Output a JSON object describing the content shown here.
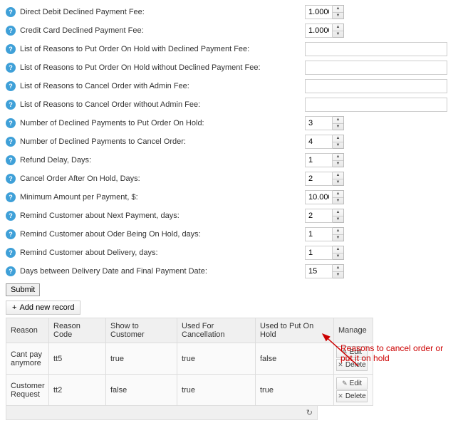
{
  "fields": {
    "direct_debit_fee": {
      "label": "Direct Debit Declined Payment Fee:",
      "value": "1.0000",
      "type": "number"
    },
    "credit_card_fee": {
      "label": "Credit Card Declined Payment Fee:",
      "value": "1.0000",
      "type": "number"
    },
    "reasons_hold_with_fee": {
      "label": "List of Reasons to Put Order On Hold with Declined Payment Fee:",
      "value": "",
      "type": "text"
    },
    "reasons_hold_without_fee": {
      "label": "List of Reasons to Put Order On Hold without Declined Payment Fee:",
      "value": "",
      "type": "text"
    },
    "reasons_cancel_with_fee": {
      "label": "List of Reasons to Cancel Order with Admin Fee:",
      "value": "",
      "type": "text"
    },
    "reasons_cancel_without_fee": {
      "label": "List of Reasons to Cancel Order without Admin Fee:",
      "value": "",
      "type": "text"
    },
    "num_declined_hold": {
      "label": "Number of Declined Payments to Put Order On Hold:",
      "value": "3",
      "type": "number"
    },
    "num_declined_cancel": {
      "label": "Number of Declined Payments to Cancel Order:",
      "value": "4",
      "type": "number"
    },
    "refund_delay": {
      "label": "Refund Delay, Days:",
      "value": "1",
      "type": "number"
    },
    "cancel_after_hold": {
      "label": "Cancel Order After On Hold, Days:",
      "value": "2",
      "type": "number"
    },
    "min_amount": {
      "label": "Minimum Amount per Payment, $:",
      "value": "10.0000",
      "type": "number"
    },
    "remind_next_payment": {
      "label": "Remind Customer about Next Payment, days:",
      "value": "2",
      "type": "number"
    },
    "remind_on_hold": {
      "label": "Remind Customer about Oder Being On Hold, days:",
      "value": "1",
      "type": "number"
    },
    "remind_delivery": {
      "label": "Remind Customer about Delivery, days:",
      "value": "1",
      "type": "number"
    },
    "days_delivery_final": {
      "label": "Days between Delivery Date and Final Payment Date:",
      "value": "15",
      "type": "number"
    }
  },
  "buttons": {
    "submit": "Submit",
    "add_record": "Add new record",
    "edit": "Edit",
    "delete": "Delete"
  },
  "grid": {
    "headers": {
      "reason": "Reason",
      "code": "Reason Code",
      "show": "Show to Customer",
      "cancel": "Used For Cancellation",
      "hold": "Used to Put On Hold",
      "manage": "Manage"
    },
    "rows": [
      {
        "reason": "Cant pay anymore",
        "code": "tt5",
        "show": "true",
        "cancel": "true",
        "hold": "false"
      },
      {
        "reason": "Customer Request",
        "code": "tt2",
        "show": "false",
        "cancel": "true",
        "hold": "true"
      }
    ]
  },
  "annotation": "Reasons to cancel order or put it on hold"
}
